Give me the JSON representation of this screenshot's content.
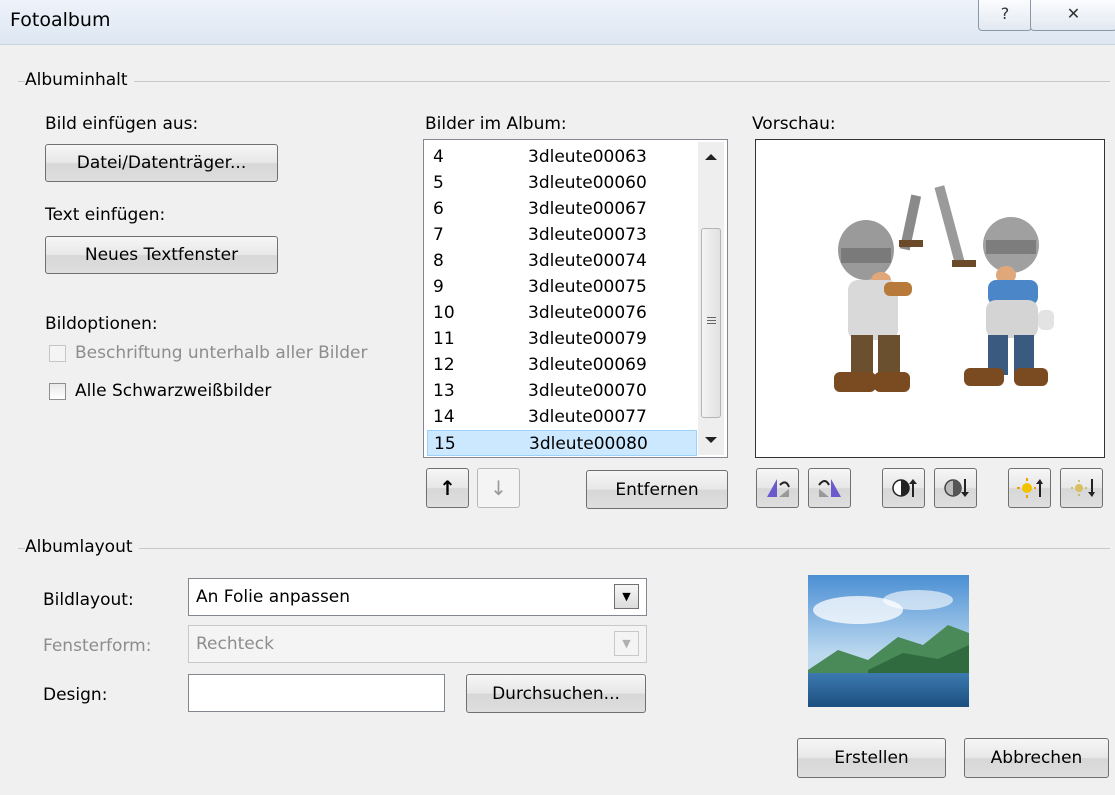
{
  "window": {
    "title": "Fotoalbum",
    "help_glyph": "?",
    "close_glyph": "✕"
  },
  "content_group": {
    "title": "Albuminhalt"
  },
  "insert": {
    "picture_label": "Bild einfügen aus:",
    "file_button": "Datei/Datenträger...",
    "text_label": "Text einfügen:",
    "textbox_button": "Neues Textfenster"
  },
  "options": {
    "label": "Bildoptionen:",
    "captions": {
      "label": "Beschriftung unterhalb aller Bilder",
      "checked": false,
      "enabled": false
    },
    "bw": {
      "label": "Alle Schwarzweißbilder",
      "checked": false,
      "enabled": true
    }
  },
  "album_list": {
    "label": "Bilder im Album:",
    "items": [
      {
        "num": "4",
        "name": "3dleute00063"
      },
      {
        "num": "5",
        "name": "3dleute00060"
      },
      {
        "num": "6",
        "name": "3dleute00067"
      },
      {
        "num": "7",
        "name": "3dleute00073"
      },
      {
        "num": "8",
        "name": "3dleute00074"
      },
      {
        "num": "9",
        "name": "3dleute00075"
      },
      {
        "num": "10",
        "name": "3dleute00076"
      },
      {
        "num": "11",
        "name": "3dleute00079"
      },
      {
        "num": "12",
        "name": "3dleute00069"
      },
      {
        "num": "13",
        "name": "3dleute00070"
      },
      {
        "num": "14",
        "name": "3dleute00077"
      },
      {
        "num": "15",
        "name": "3dleute00080"
      }
    ],
    "selected_index": 11,
    "move_up_glyph": "↑",
    "move_down_glyph": "↓",
    "remove_button": "Entfernen"
  },
  "preview": {
    "label": "Vorschau:"
  },
  "layout_group": {
    "title": "Albumlayout"
  },
  "layout": {
    "picture_layout_label": "Bildlayout:",
    "picture_layout_value": "An Folie anpassen",
    "frame_shape_label": "Fensterform:",
    "frame_shape_value": "Rechteck",
    "design_label": "Design:",
    "design_value": "",
    "browse_button": "Durchsuchen..."
  },
  "footer": {
    "create_button": "Erstellen",
    "cancel_button": "Abbrechen"
  },
  "colors": {
    "selection": "#cce8ff",
    "accent_border": "#99d1ff",
    "dialog_bg": "#f0f0f0"
  }
}
